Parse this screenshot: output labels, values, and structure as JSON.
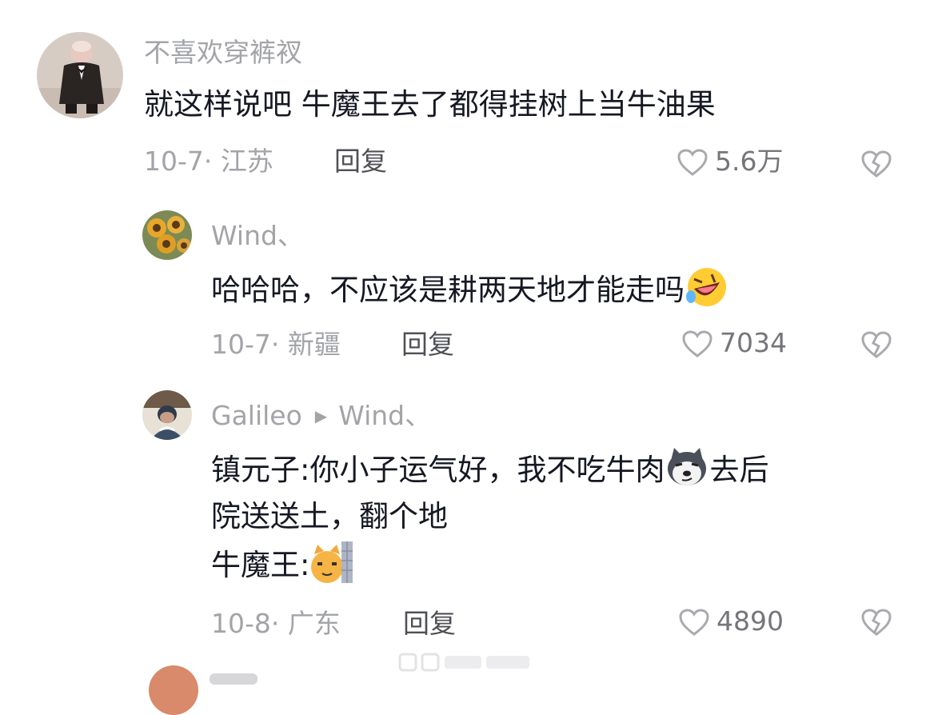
{
  "comments": [
    {
      "username": "不喜欢穿裤衩",
      "text": "就这样说吧 牛魔王去了都得挂树上当牛油果",
      "meta": "10-7· 江苏",
      "reply_label": "回复",
      "likes": "5.6万",
      "avatar": "monkey-in-suit-avatar"
    },
    {
      "username": "Wind、",
      "text": "哈哈哈，不应该是耕两天地才能走吗",
      "emoji": "rolling-laughing-emoji",
      "meta": "10-7· 新疆",
      "reply_label": "回复",
      "likes": "7034",
      "avatar": "sunflowers-avatar"
    },
    {
      "username": "Galileo",
      "reply_to": "Wind、",
      "text_line1": "镇元子:你小子运气好，我不吃牛肉",
      "text_line1_end": "去后",
      "emoji_dog": "doge-emoji",
      "text_line2": "院送送土，翻个地",
      "text_line3": "牛魔王:",
      "emoji_cat": "cat-peeking-emoji",
      "meta": "10-8· 广东",
      "reply_label": "回复",
      "likes": "4890",
      "avatar": "man-portrait-avatar"
    }
  ],
  "colors": {
    "text": "#161823",
    "secondary": "#a3a4a8",
    "reply": "#4f5055",
    "icon": "#a9aaae"
  }
}
